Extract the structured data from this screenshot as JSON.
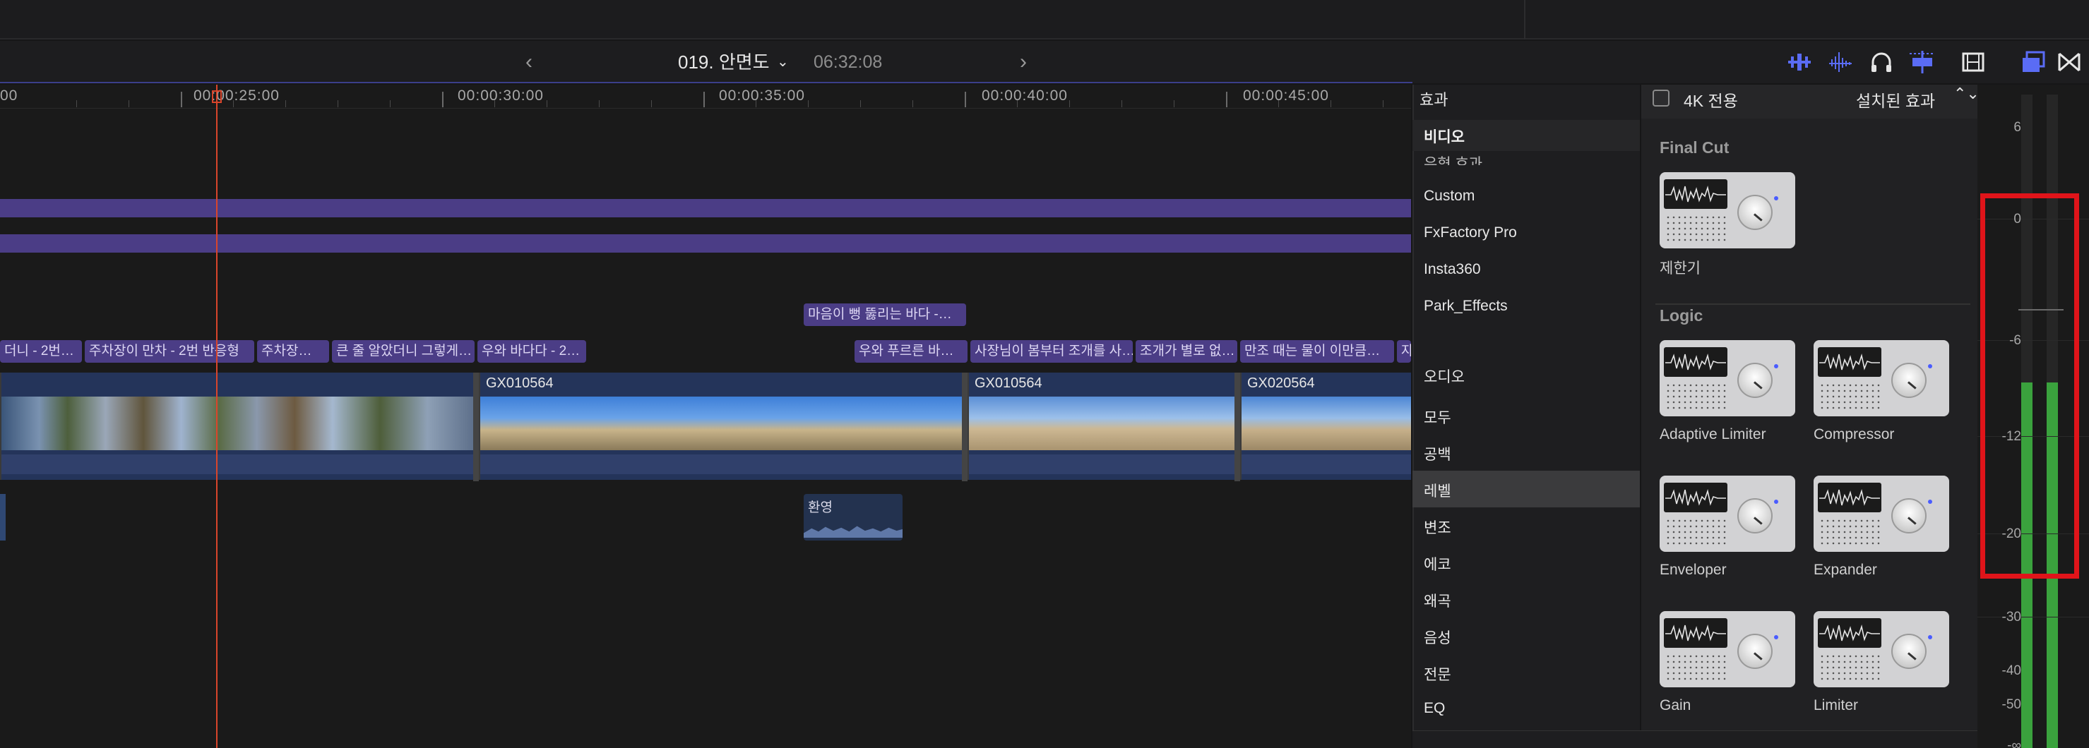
{
  "toolbar": {
    "project_title": "019. 안면도",
    "duration": "06:32:08",
    "prev_label": "‹",
    "next_label": "›",
    "chevron": "⌄"
  },
  "timeline": {
    "ruler_labels": [
      "00",
      "00:00:25:00",
      "00:00:30:00",
      "00:00:35:00",
      "00:00:40:00",
      "00:00:45:00"
    ],
    "title_clips_top": [
      "마음이 뻥 뚫리는 바다 -…"
    ],
    "title_clips": [
      "더니 - 2번…",
      "주차장이 만차 - 2번 반응형",
      "주차장…",
      "큰 줄 알았더니 그렇게…",
      "우와 바다다 - 2…",
      "우와 푸르른 바…",
      "사장님이 봄부터 조개를 사…",
      "조개가 별로 없…",
      "만조 때는 물이 이만큼…",
      "자"
    ],
    "video_clips": [
      "",
      "GX010564",
      "GX010564",
      "GX020564"
    ],
    "audio_clip": "환영"
  },
  "effects_panel": {
    "title": "효과",
    "categories_header": "비디오",
    "categories_partial": "유형 효과",
    "categories_top": [
      "Custom",
      "FxFactory Pro",
      "Insta360",
      "Park_Effects"
    ],
    "audio_header": "오디오",
    "audio_categories": [
      "모두",
      "공백",
      "레벨",
      "변조",
      "에코",
      "왜곡",
      "음성",
      "전문",
      "EQ"
    ],
    "selected_category": "레벨"
  },
  "browser": {
    "checkbox_label": "4K 전용",
    "installed_label": "설치된 효과",
    "installed_chevron": "⌃⌄",
    "sections": [
      {
        "name": "Final Cut",
        "items": [
          "제한기"
        ]
      },
      {
        "name": "Logic",
        "items": [
          "Adaptive Limiter",
          "Compressor",
          "Enveloper",
          "Expander",
          "Gain",
          "Limiter"
        ]
      }
    ]
  },
  "meter": {
    "labels": [
      "6",
      "0",
      "-6",
      "-12",
      "-20",
      "-30",
      "-40",
      "-50",
      "-∞"
    ],
    "level_db": -12
  },
  "colors": {
    "accent": "#4a5cff",
    "playhead": "#d9452b",
    "title_clip": "#4b3d86",
    "meter_green": "#3aa23d",
    "highlight": "#e0141a"
  }
}
